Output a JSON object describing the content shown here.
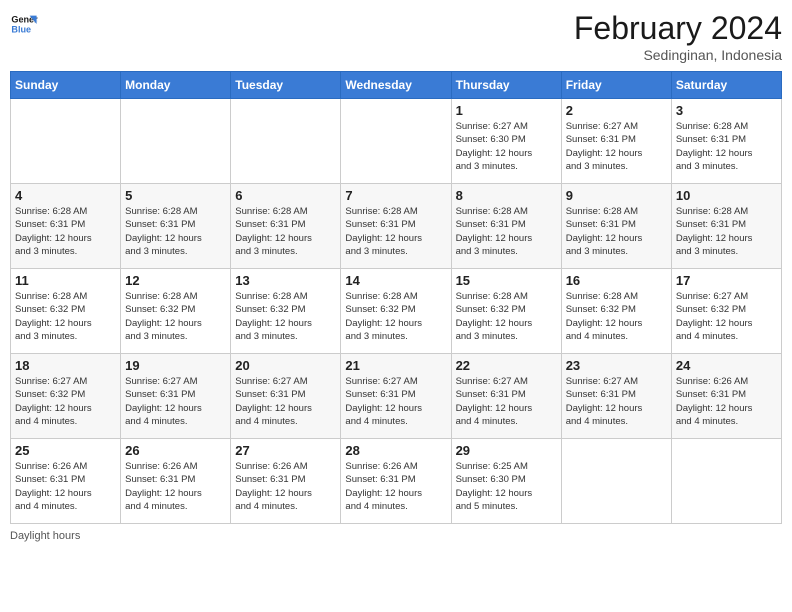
{
  "logo": {
    "line1": "General",
    "line2": "Blue"
  },
  "header": {
    "title": "February 2024",
    "subtitle": "Sedinginan, Indonesia"
  },
  "weekdays": [
    "Sunday",
    "Monday",
    "Tuesday",
    "Wednesday",
    "Thursday",
    "Friday",
    "Saturday"
  ],
  "footer": {
    "label": "Daylight hours"
  },
  "weeks": [
    [
      {
        "day": "",
        "info": ""
      },
      {
        "day": "",
        "info": ""
      },
      {
        "day": "",
        "info": ""
      },
      {
        "day": "",
        "info": ""
      },
      {
        "day": "1",
        "info": "Sunrise: 6:27 AM\nSunset: 6:30 PM\nDaylight: 12 hours\nand 3 minutes."
      },
      {
        "day": "2",
        "info": "Sunrise: 6:27 AM\nSunset: 6:31 PM\nDaylight: 12 hours\nand 3 minutes."
      },
      {
        "day": "3",
        "info": "Sunrise: 6:28 AM\nSunset: 6:31 PM\nDaylight: 12 hours\nand 3 minutes."
      }
    ],
    [
      {
        "day": "4",
        "info": "Sunrise: 6:28 AM\nSunset: 6:31 PM\nDaylight: 12 hours\nand 3 minutes."
      },
      {
        "day": "5",
        "info": "Sunrise: 6:28 AM\nSunset: 6:31 PM\nDaylight: 12 hours\nand 3 minutes."
      },
      {
        "day": "6",
        "info": "Sunrise: 6:28 AM\nSunset: 6:31 PM\nDaylight: 12 hours\nand 3 minutes."
      },
      {
        "day": "7",
        "info": "Sunrise: 6:28 AM\nSunset: 6:31 PM\nDaylight: 12 hours\nand 3 minutes."
      },
      {
        "day": "8",
        "info": "Sunrise: 6:28 AM\nSunset: 6:31 PM\nDaylight: 12 hours\nand 3 minutes."
      },
      {
        "day": "9",
        "info": "Sunrise: 6:28 AM\nSunset: 6:31 PM\nDaylight: 12 hours\nand 3 minutes."
      },
      {
        "day": "10",
        "info": "Sunrise: 6:28 AM\nSunset: 6:31 PM\nDaylight: 12 hours\nand 3 minutes."
      }
    ],
    [
      {
        "day": "11",
        "info": "Sunrise: 6:28 AM\nSunset: 6:32 PM\nDaylight: 12 hours\nand 3 minutes."
      },
      {
        "day": "12",
        "info": "Sunrise: 6:28 AM\nSunset: 6:32 PM\nDaylight: 12 hours\nand 3 minutes."
      },
      {
        "day": "13",
        "info": "Sunrise: 6:28 AM\nSunset: 6:32 PM\nDaylight: 12 hours\nand 3 minutes."
      },
      {
        "day": "14",
        "info": "Sunrise: 6:28 AM\nSunset: 6:32 PM\nDaylight: 12 hours\nand 3 minutes."
      },
      {
        "day": "15",
        "info": "Sunrise: 6:28 AM\nSunset: 6:32 PM\nDaylight: 12 hours\nand 3 minutes."
      },
      {
        "day": "16",
        "info": "Sunrise: 6:28 AM\nSunset: 6:32 PM\nDaylight: 12 hours\nand 4 minutes."
      },
      {
        "day": "17",
        "info": "Sunrise: 6:27 AM\nSunset: 6:32 PM\nDaylight: 12 hours\nand 4 minutes."
      }
    ],
    [
      {
        "day": "18",
        "info": "Sunrise: 6:27 AM\nSunset: 6:32 PM\nDaylight: 12 hours\nand 4 minutes."
      },
      {
        "day": "19",
        "info": "Sunrise: 6:27 AM\nSunset: 6:31 PM\nDaylight: 12 hours\nand 4 minutes."
      },
      {
        "day": "20",
        "info": "Sunrise: 6:27 AM\nSunset: 6:31 PM\nDaylight: 12 hours\nand 4 minutes."
      },
      {
        "day": "21",
        "info": "Sunrise: 6:27 AM\nSunset: 6:31 PM\nDaylight: 12 hours\nand 4 minutes."
      },
      {
        "day": "22",
        "info": "Sunrise: 6:27 AM\nSunset: 6:31 PM\nDaylight: 12 hours\nand 4 minutes."
      },
      {
        "day": "23",
        "info": "Sunrise: 6:27 AM\nSunset: 6:31 PM\nDaylight: 12 hours\nand 4 minutes."
      },
      {
        "day": "24",
        "info": "Sunrise: 6:26 AM\nSunset: 6:31 PM\nDaylight: 12 hours\nand 4 minutes."
      }
    ],
    [
      {
        "day": "25",
        "info": "Sunrise: 6:26 AM\nSunset: 6:31 PM\nDaylight: 12 hours\nand 4 minutes."
      },
      {
        "day": "26",
        "info": "Sunrise: 6:26 AM\nSunset: 6:31 PM\nDaylight: 12 hours\nand 4 minutes."
      },
      {
        "day": "27",
        "info": "Sunrise: 6:26 AM\nSunset: 6:31 PM\nDaylight: 12 hours\nand 4 minutes."
      },
      {
        "day": "28",
        "info": "Sunrise: 6:26 AM\nSunset: 6:31 PM\nDaylight: 12 hours\nand 4 minutes."
      },
      {
        "day": "29",
        "info": "Sunrise: 6:25 AM\nSunset: 6:30 PM\nDaylight: 12 hours\nand 5 minutes."
      },
      {
        "day": "",
        "info": ""
      },
      {
        "day": "",
        "info": ""
      }
    ]
  ]
}
